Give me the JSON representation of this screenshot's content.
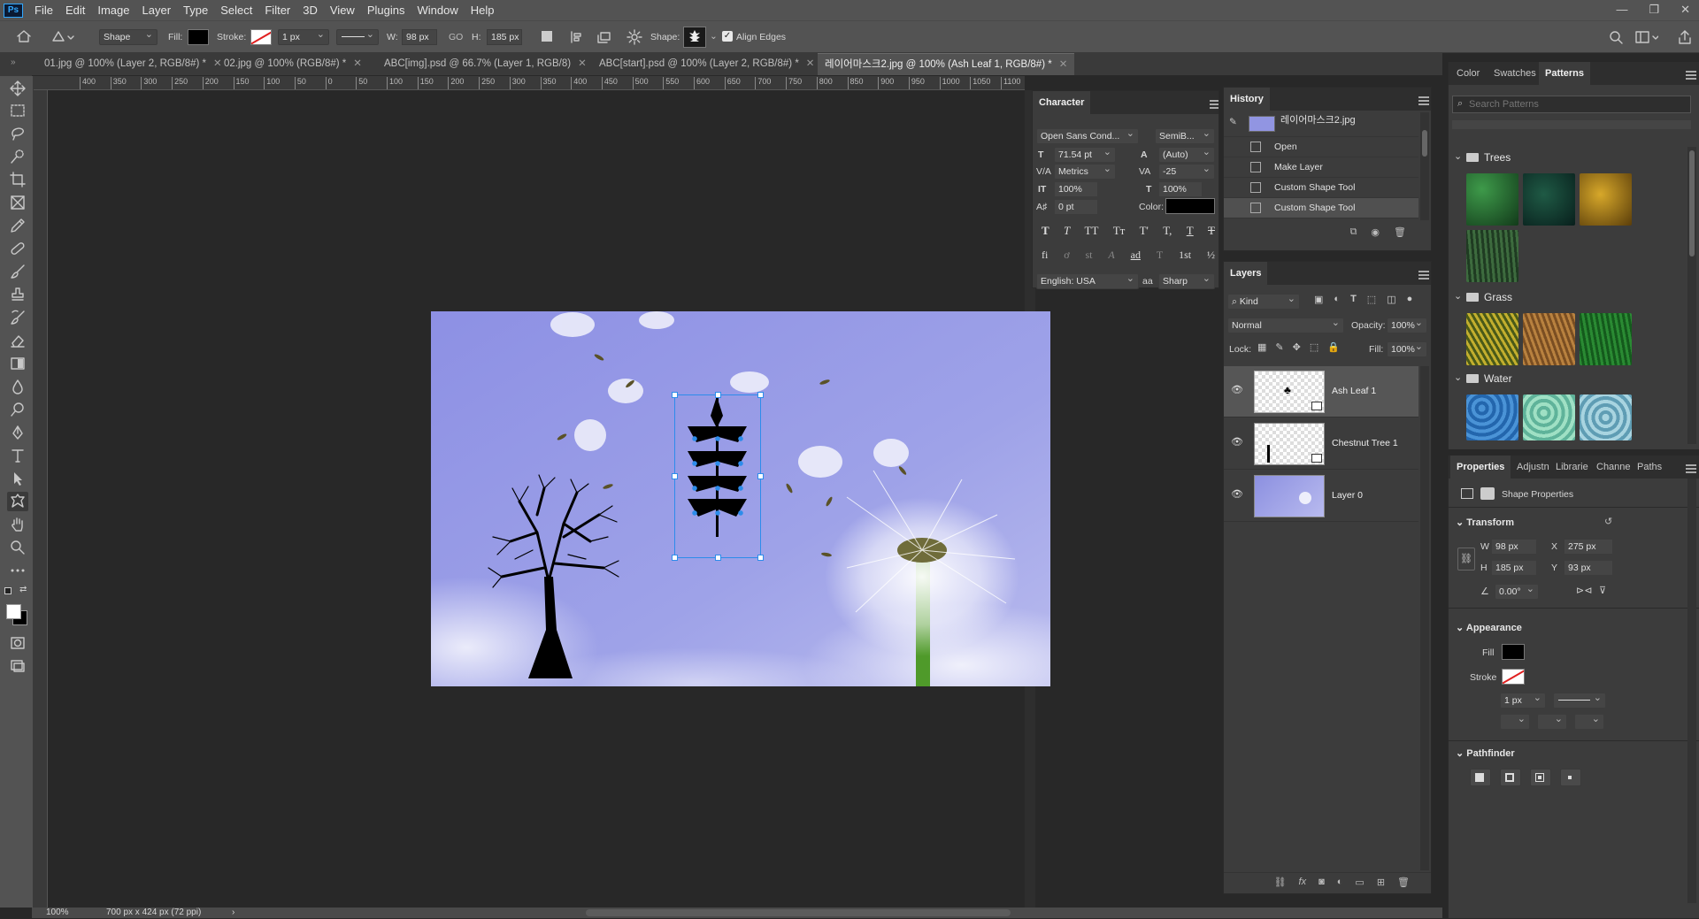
{
  "app": {
    "logo": "Ps"
  },
  "menu": [
    "File",
    "Edit",
    "Image",
    "Layer",
    "Type",
    "Select",
    "Filter",
    "3D",
    "View",
    "Plugins",
    "Window",
    "Help"
  ],
  "options": {
    "mode": "Shape",
    "fill_label": "Fill:",
    "stroke_label": "Stroke:",
    "stroke_width": "1 px",
    "w_label": "W:",
    "w_value": "98 px",
    "link_label": "GO",
    "h_label": "H:",
    "h_value": "185 px",
    "shape_label": "Shape:",
    "align_edges": "Align Edges"
  },
  "tabs": [
    {
      "label": "01.jpg @ 100% (Layer 2, RGB/8#) *"
    },
    {
      "label": "02.jpg @ 100% (RGB/8#) *"
    },
    {
      "label": "ABC[img].psd @ 66.7% (Layer 1, RGB/8)"
    },
    {
      "label": "ABC[start].psd @ 100% (Layer 2, RGB/8#) *"
    },
    {
      "label": "레이어마스크2.jpg @ 100% (Ash Leaf 1, RGB/8#) *"
    }
  ],
  "ruler_ticks": [
    "400",
    "350",
    "300",
    "250",
    "200",
    "150",
    "100",
    "50",
    "0",
    "50",
    "100",
    "150",
    "200",
    "250",
    "300",
    "350",
    "400",
    "450",
    "500",
    "550",
    "600",
    "650",
    "700",
    "750",
    "800",
    "850",
    "900",
    "950",
    "1000",
    "1050",
    "1100"
  ],
  "status": {
    "zoom": "100%",
    "doc_info": "700 px x 424 px (72 ppi)"
  },
  "character": {
    "title": "Character",
    "font_family": "Open Sans Cond...",
    "font_style": "SemiB...",
    "size": "71.54 pt",
    "leading": "(Auto)",
    "kerning": "Metrics",
    "tracking": "-25",
    "vscale": "100%",
    "hscale": "100%",
    "baseline": "0 pt",
    "color_label": "Color:",
    "language": "English: USA",
    "antialias": "Sharp",
    "style_buttons": [
      "T",
      "T",
      "TT",
      "Tт",
      "T'",
      "T,",
      "T",
      "T"
    ],
    "ot_buttons": [
      "fi",
      "ơ",
      "st",
      "A",
      "ad",
      "T",
      "1st",
      "½"
    ]
  },
  "history": {
    "title": "History",
    "snapshot": "레이어마스크2.jpg",
    "steps": [
      "Open",
      "Make Layer",
      "Custom Shape Tool",
      "Custom Shape Tool"
    ]
  },
  "layers": {
    "title": "Layers",
    "kind": "Kind",
    "blend": "Normal",
    "opacity_label": "Opacity:",
    "opacity": "100%",
    "lock_label": "Lock:",
    "fill_label": "Fill:",
    "fill": "100%",
    "items": [
      {
        "name": "Ash Leaf 1",
        "selected": true
      },
      {
        "name": "Chestnut Tree 1",
        "selected": false
      },
      {
        "name": "Layer 0",
        "selected": false
      }
    ]
  },
  "patterns_panel": {
    "tabs": [
      "Color",
      "Swatches",
      "Patterns"
    ],
    "search_placeholder": "Search Patterns",
    "groups": [
      {
        "name": "Trees",
        "colors": [
          "#1f5a2c",
          "#0e3a33",
          "#a8861c",
          "#3e5a3a"
        ]
      },
      {
        "name": "Grass",
        "colors": [
          "#8a8a25",
          "#a76f35",
          "#1e6a25"
        ]
      },
      {
        "name": "Water",
        "colors": [
          "#3c7fc6",
          "#7fc7b0",
          "#80b8c8"
        ]
      }
    ]
  },
  "properties": {
    "tabs": [
      "Properties",
      "Adjustn",
      "Librarie",
      "Channe",
      "Paths"
    ],
    "kind": "Shape Properties",
    "transform_title": "Transform",
    "w_label": "W",
    "w": "98 px",
    "x_label": "X",
    "x": "275 px",
    "h_label": "H",
    "h": "185 px",
    "y_label": "Y",
    "y": "93 px",
    "angle": "0.00°",
    "appearance_title": "Appearance",
    "fill_label": "Fill",
    "stroke_label": "Stroke",
    "stroke_width": "1 px",
    "pathfinder_title": "Pathfinder"
  },
  "colors": {
    "accent": "#2d8ceb",
    "canvas_sky": "#8c90e0",
    "workspace": "#282828"
  }
}
